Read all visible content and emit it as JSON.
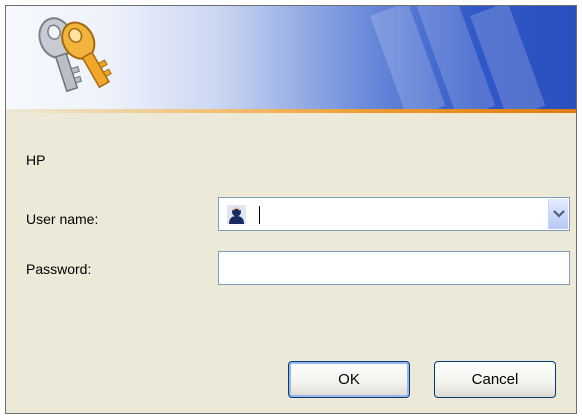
{
  "dialog": {
    "server": "HP",
    "user_label": "User name:",
    "password_label": "Password:",
    "user_value": "",
    "password_value": "",
    "ok_label": "OK",
    "cancel_label": "Cancel"
  },
  "icons": {
    "banner": "keys-icon",
    "user": "user-avatar-icon",
    "dropdown": "chevron-down-icon"
  },
  "colors": {
    "accent": "#2a4fbe",
    "banner_stripe": "#ef9a2c",
    "background": "#ece9d8",
    "input_border": "#7f9db9"
  }
}
